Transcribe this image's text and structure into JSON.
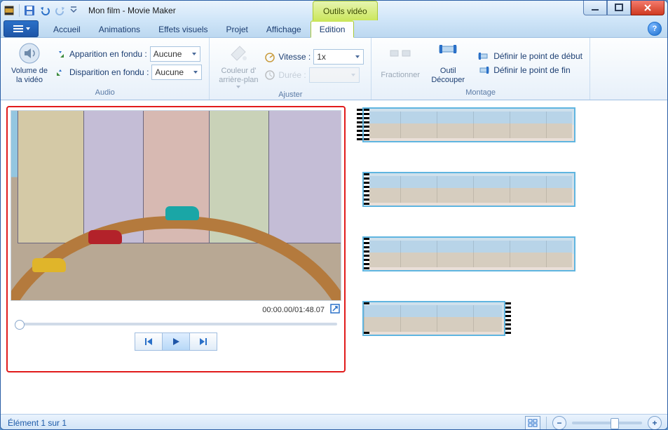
{
  "titlebar": {
    "title": "Mon film - Movie Maker",
    "contextual_label": "Outils vidéo"
  },
  "tabs": {
    "accueil": "Accueil",
    "animations": "Animations",
    "effets": "Effets visuels",
    "projet": "Projet",
    "affichage": "Affichage",
    "edition": "Edition"
  },
  "ribbon": {
    "audio": {
      "group_title": "Audio",
      "volume_label": "Volume de\nla vidéo",
      "fade_in_label": "Apparition en fondu :",
      "fade_in_value": "Aucune",
      "fade_out_label": "Disparition en fondu :",
      "fade_out_value": "Aucune"
    },
    "ajuster": {
      "group_title": "Ajuster",
      "bgcolor_label": "Couleur d'\narrière-plan",
      "speed_label": "Vitesse :",
      "speed_value": "1x",
      "duration_label": "Durée :",
      "duration_value": ""
    },
    "montage": {
      "group_title": "Montage",
      "split_label": "Fractionner",
      "trim_label": "Outil\nDécouper",
      "set_start_label": "Définir le point de début",
      "set_end_label": "Définir le point de fin"
    }
  },
  "preview": {
    "time": "00:00.00/01:48.07"
  },
  "statusbar": {
    "item_count": "Élément 1 sur 1"
  },
  "chart_data": null
}
